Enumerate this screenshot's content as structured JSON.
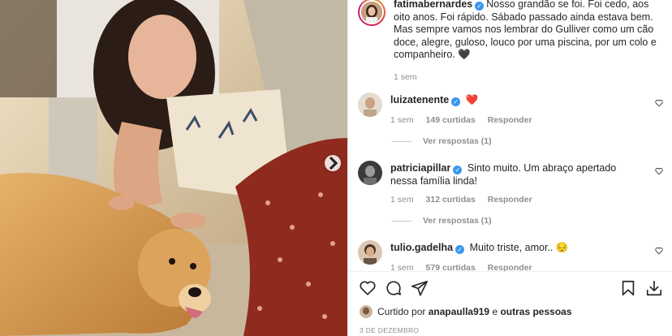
{
  "post": {
    "author": "fatimabernardes",
    "caption": "Nosso grandão se foi. Foi cedo, aos oito anos. Foi rápido. Sábado passado ainda estava bem. Mas sempre vamos nos lembrar do Gulliver como um cão doce, alegre, guloso, louco por uma piscina, por um colo e companheiro. 🖤",
    "time": "1 sem"
  },
  "comments": [
    {
      "user": "luizatenente",
      "text": "❤️",
      "time": "1 sem",
      "likes": "149 curtidas",
      "reply": "Responder",
      "replies": "Ver respostas (1)"
    },
    {
      "user": "patriciapillar",
      "text": "Sinto muito. Um abraço apertado nessa família linda!",
      "time": "1 sem",
      "likes": "312 curtidas",
      "reply": "Responder",
      "replies": "Ver respostas (1)"
    },
    {
      "user": "tulio.gadelha",
      "text": "Muito triste, amor.. 😔",
      "time": "1 sem",
      "likes": "579 curtidas",
      "reply": "Responder"
    }
  ],
  "footer": {
    "liked_prefix": "Curtido por",
    "liked_user": "anapaulla919",
    "liked_joiner": "e",
    "liked_others": "outras pessoas",
    "date": "3 DE DEZEMBRO"
  },
  "icons": {
    "like": "heart-icon",
    "comment": "comment-icon",
    "share": "share-icon",
    "save": "bookmark-icon",
    "download": "download-icon",
    "next": "chevron-right-icon"
  },
  "colors": {
    "verified": "#3897f0",
    "muted": "#8e8e8e",
    "text": "#262626"
  }
}
